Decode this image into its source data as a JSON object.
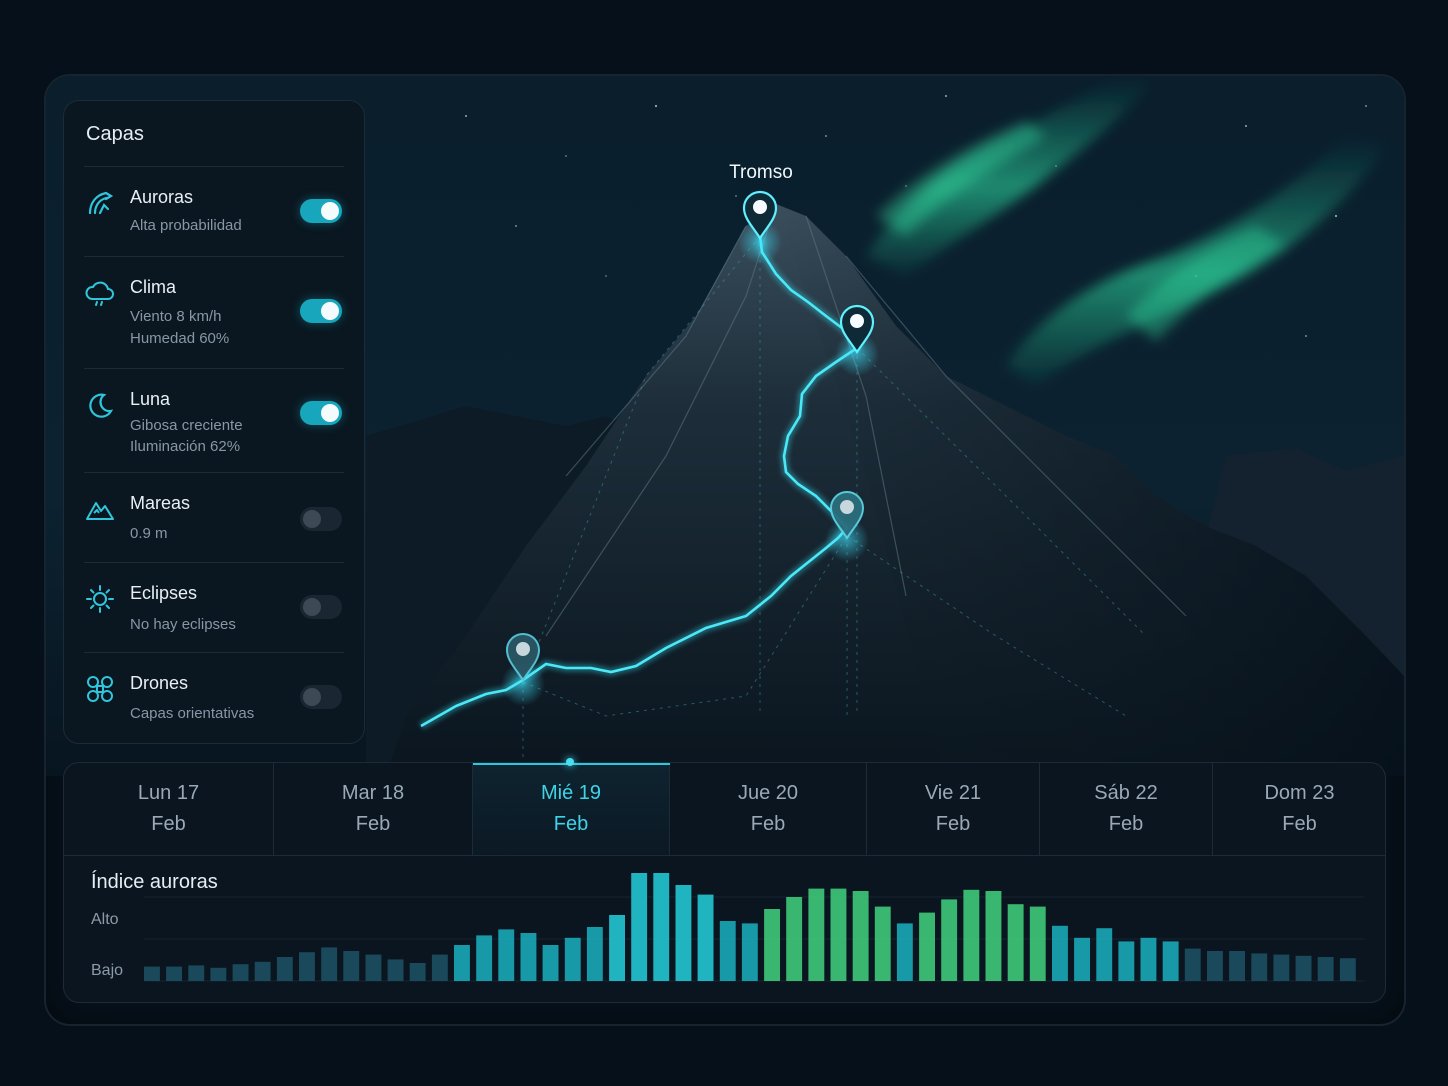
{
  "layers_panel": {
    "title": "Capas",
    "items": [
      {
        "title": "Auroras",
        "sub1": "Alta probabilidad",
        "sub2": "",
        "enabled": true,
        "icon": "aurora-icon"
      },
      {
        "title": "Clima",
        "sub1": "Viento 8 km/h",
        "sub2": "Humedad 60%",
        "enabled": true,
        "icon": "cloud-icon"
      },
      {
        "title": "Luna",
        "sub1": "Gibosa creciente",
        "sub2": "Iluminación 62%",
        "enabled": true,
        "icon": "moon-icon"
      },
      {
        "title": "Mareas",
        "sub1": "0.9 m",
        "sub2": "",
        "enabled": false,
        "icon": "mountain-icon"
      },
      {
        "title": "Eclipses",
        "sub1": "No hay eclipses",
        "sub2": "",
        "enabled": false,
        "icon": "sun-icon"
      },
      {
        "title": "Drones",
        "sub1": "Capas orientativas",
        "sub2": "",
        "enabled": false,
        "icon": "drone-icon"
      }
    ]
  },
  "map": {
    "summit_label": "Tromso"
  },
  "days": [
    {
      "day": "Lun 17",
      "month": "Feb",
      "active": false
    },
    {
      "day": "Mar 18",
      "month": "Feb",
      "active": false
    },
    {
      "day": "Mié 19",
      "month": "Feb",
      "active": true
    },
    {
      "day": "Jue 20",
      "month": "Feb",
      "active": false
    },
    {
      "day": "Vie 21",
      "month": "Feb",
      "active": false
    },
    {
      "day": "Sáb 22",
      "month": "Feb",
      "active": false
    },
    {
      "day": "Dom 23",
      "month": "Feb",
      "active": false
    }
  ],
  "chart_data": {
    "type": "bar",
    "title": "Índice auroras",
    "y_labels": [
      "Alto",
      "Bajo"
    ],
    "values": [
      0.12,
      0.12,
      0.13,
      0.11,
      0.14,
      0.16,
      0.2,
      0.24,
      0.28,
      0.25,
      0.22,
      0.18,
      0.15,
      0.22,
      0.3,
      0.38,
      0.43,
      0.4,
      0.3,
      0.36,
      0.45,
      0.55,
      0.9,
      0.9,
      0.8,
      0.72,
      0.5,
      0.48,
      0.6,
      0.7,
      0.77,
      0.77,
      0.75,
      0.62,
      0.48,
      0.57,
      0.68,
      0.76,
      0.75,
      0.64,
      0.62,
      0.46,
      0.36,
      0.44,
      0.33,
      0.36,
      0.33,
      0.27,
      0.25,
      0.25,
      0.23,
      0.22,
      0.21,
      0.2,
      0.19
    ],
    "colors": {
      "low": "#1f5b6e",
      "mid": "#1aa7b7",
      "high_teal": "#22c5d1",
      "high_green": "#3ec97a"
    }
  }
}
